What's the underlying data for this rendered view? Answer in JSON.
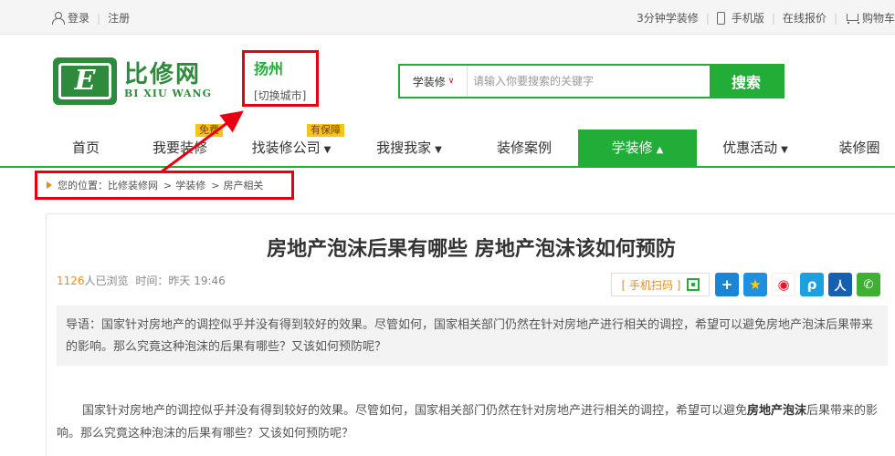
{
  "topbar": {
    "login": "登录",
    "register": "注册",
    "learn": "3分钟学装修",
    "mobile": "手机版",
    "quote": "在线报价",
    "cart": "购物车"
  },
  "logo": {
    "cn": "比修网",
    "en": "BI XIU WANG",
    "mark": "E"
  },
  "city": {
    "name": "扬州",
    "switch": "[切换城市]"
  },
  "search": {
    "type": "学装修",
    "placeholder": "请输入你要搜索的关键字",
    "button": "搜索"
  },
  "nav": {
    "items": [
      {
        "label": "首页",
        "dropdown": false
      },
      {
        "label": "我要装修",
        "dropdown": false,
        "badge": "免费"
      },
      {
        "label": "找装修公司",
        "dropdown": true,
        "badge": "有保障"
      },
      {
        "label": "我搜我家",
        "dropdown": true
      },
      {
        "label": "装修案例",
        "dropdown": false
      },
      {
        "label": "学装修",
        "dropdown": true,
        "active": true
      },
      {
        "label": "优惠活动",
        "dropdown": true
      },
      {
        "label": "装修圈",
        "dropdown": false
      }
    ]
  },
  "breadcrumb": {
    "prefix": "您的位置：",
    "items": [
      "比修装修网",
      "学装修",
      "房产相关"
    ]
  },
  "article": {
    "title": "房地产泡沫后果有哪些 房地产泡沫该如何预防",
    "views": "1126",
    "views_suffix": "人已浏览",
    "time_label": "时间：",
    "time": "昨天 19:46",
    "qr_label": "[ 手机扫码 ]",
    "lead": "导语：国家针对房地产的调控似乎并没有得到较好的效果。尽管如何，国家相关部门仍然在针对房地产进行相关的调控，希望可以避免房地产泡沫后果带来的影响。那么究竟这种泡沫的后果有哪些？又该如何预防呢？",
    "body_a": "国家针对房地产的调控似乎并没有得到较好的效果。尽管如何，国家相关部门仍然在针对房地产进行相关的调控，希望可以避免",
    "body_bold": "房地产泡沫",
    "body_b": "后果带来的影响。那么究竟这种泡沫的后果有哪些？又该如何预防呢？"
  },
  "share_icons": [
    {
      "name": "more-share-icon",
      "color": "#1a84d6",
      "glyph": "+"
    },
    {
      "name": "qzone-icon",
      "color": "#1f8fe0",
      "glyph": "★"
    },
    {
      "name": "weibo-icon",
      "color": "#e6162d",
      "glyph": "◉"
    },
    {
      "name": "tencent-weibo-icon",
      "color": "#1d9fe0",
      "glyph": "ρ"
    },
    {
      "name": "renren-icon",
      "color": "#1560b0",
      "glyph": "人"
    },
    {
      "name": "wechat-icon",
      "color": "#3eb135",
      "glyph": "✆"
    }
  ],
  "colors": {
    "brand_green": "#22ac38",
    "annotation_red": "#e60012",
    "accent_orange": "#e58e1a"
  }
}
